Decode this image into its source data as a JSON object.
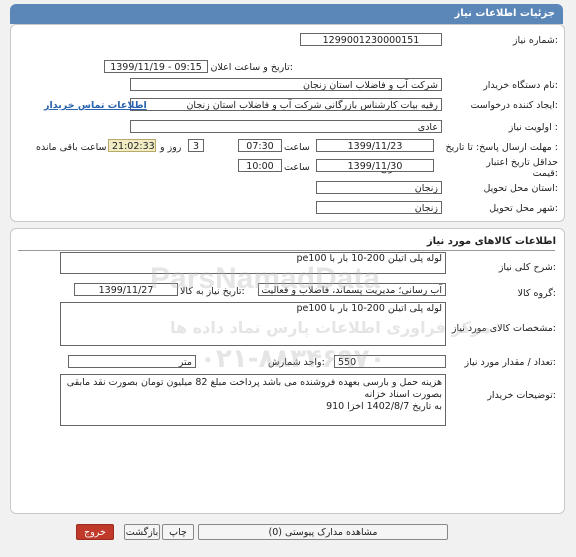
{
  "header": {
    "title": "جزئیات اطلاعات نیاز"
  },
  "details": {
    "need_number_label": "شماره نیاز:",
    "need_number": "1299001230000151",
    "announce_label": "تاریخ و ساعت اعلان عمومی:",
    "announce_value": "1399/11/19 - 09:15",
    "buyer_label": "نام دستگاه خریدار:",
    "buyer": "شرکت آب و فاضلاب استان زنجان",
    "creator_label": "ایجاد کننده درخواست:",
    "creator": "رقیه بیات کارشناس بازرگانی شرکت آب و فاضلاب استان زنجان",
    "contact_link": "اطلاعات تماس خریدار",
    "priority_label": "اولویت نیاز :",
    "priority": "عادی",
    "reply_deadline_label": "مهلت ارسال پاسخ: تا تاریخ :",
    "reply_date": "1399/11/23",
    "time_label": "ساعت",
    "reply_time": "07:30",
    "days": "3",
    "days_label": "روز و",
    "remaining_time": "21:02:33",
    "remaining_label": "ساعت باقی مانده",
    "price_validity_label": "حداقل تاریخ اعتبار قیمت:",
    "price_validity_to": "تا تاریخ :",
    "price_date": "1399/11/30",
    "price_time": "10:00",
    "province_label": "استان محل تحویل:",
    "province": "زنجان",
    "city_label": "شهر محل تحویل:",
    "city": "زنجان"
  },
  "goods": {
    "section_title": "اطلاعات کالاهای مورد نیاز",
    "summary_label": "شرح کلی نیاز:",
    "summary": "لوله پلی اتیلن 200-10 بار با pe100",
    "group_label": "گروه کالا:",
    "group": "آب رسانی؛ مدیریت پسماند، فاضلاب و فعالیت ها",
    "need_date_label": "تاریخ نیاز به کالا:",
    "need_date": "1399/11/27",
    "specs_label": "مشخصات کالای مورد نیاز:",
    "specs": "لوله پلی اتیلن 200-10 بار با pe100",
    "qty_label": "تعداد / مقدار مورد نیاز:",
    "qty": "550",
    "unit_label": "واحد شمارش:",
    "unit": "متر",
    "notes_label": "توضیحات خریدار:",
    "notes_line1": "هزینه حمل و بارسی بعهده فروشنده می باشد پرداخت مبلغ 82 میلیون تومان بصورت نقد مابقی بصورت اسناد خزانه",
    "notes_line2": "به تاریخ 1402/8/7 اخزا 910"
  },
  "watermark": {
    "line1": "ParsNamadData",
    "line2": "مرکز فراوری اطلاعات پارس نماد داده ها",
    "line3": "۰۲۱-۸۸۳۴۶۹۷۰"
  },
  "buttons": {
    "attachments": "مشاهده مدارک پیوستی (0)",
    "print": "چاپ",
    "back": "بازگشت",
    "exit": "خروج"
  }
}
